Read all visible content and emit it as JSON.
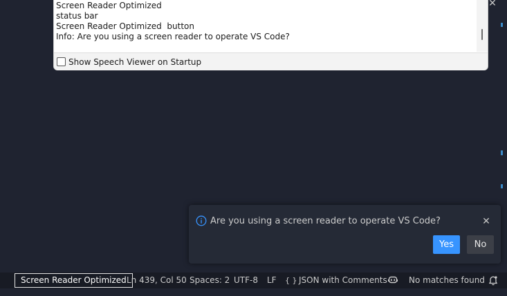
{
  "speech_viewer": {
    "lines": [
      "Screen Reader Optimized",
      "status bar",
      "Screen Reader Optimized  button",
      "Info: Are you using a screen reader to operate VS Code?"
    ],
    "show_on_startup_label": "Show Speech Viewer on Startup",
    "show_on_startup_checked": false,
    "close_glyph": "✕"
  },
  "notification": {
    "icon": "info-icon",
    "message": "Are you using a screen reader to operate VS Code?",
    "close_glyph": "✕",
    "yes_label": "Yes",
    "no_label": "No",
    "accent": "#3794ff"
  },
  "status_bar": {
    "screen_reader_label": "Screen Reader Optimized",
    "cursor_position": "Ln 439, Col 50",
    "indentation": "Spaces: 2",
    "encoding": "UTF-8",
    "eol": "LF",
    "language_glyph": "{ }",
    "language": "JSON with Comments",
    "copilot_icon": "copilot-icon",
    "search_status": "No matches found",
    "notifications_icon": "bell-icon"
  }
}
